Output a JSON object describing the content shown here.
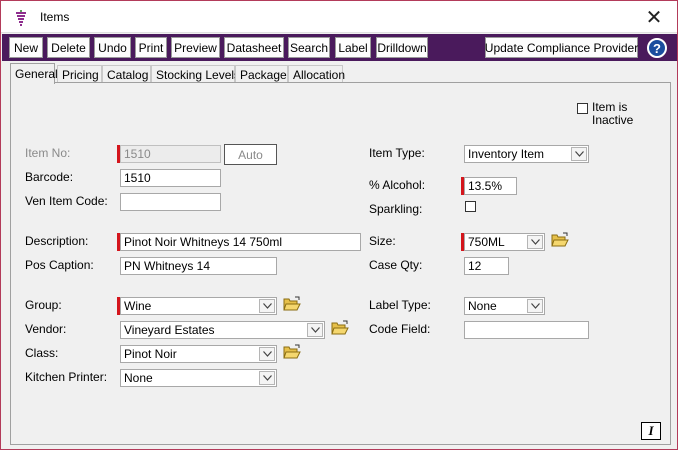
{
  "window": {
    "title": "Items",
    "close_glyph": "✕"
  },
  "toolbar": {
    "buttons": [
      "New",
      "Delete",
      "Undo",
      "Print",
      "Preview",
      "Datasheet",
      "Search",
      "Label",
      "Drilldown"
    ],
    "compliance_label": "Update Compliance Provider",
    "help_glyph": "?"
  },
  "tabs": [
    "General",
    "Pricing",
    "Catalog",
    "Stocking Levels",
    "Package",
    "Allocation"
  ],
  "form": {
    "inactive_label": "Item is Inactive",
    "item_no": {
      "label": "Item No:",
      "value": "1510"
    },
    "auto_label": "Auto",
    "barcode": {
      "label": "Barcode:",
      "value": "1510"
    },
    "ven_item_code": {
      "label": "Ven Item Code:",
      "value": ""
    },
    "description": {
      "label": "Description:",
      "value": "Pinot Noir Whitneys 14 750ml"
    },
    "pos_caption": {
      "label": "Pos Caption:",
      "value": "PN Whitneys 14"
    },
    "group": {
      "label": "Group:",
      "value": "Wine"
    },
    "vendor": {
      "label": "Vendor:",
      "value": "Vineyard Estates"
    },
    "class": {
      "label": "Class:",
      "value": "Pinot Noir"
    },
    "kitchen_printer": {
      "label": "Kitchen Printer:",
      "value": "None"
    },
    "item_type": {
      "label": "Item Type:",
      "value": "Inventory Item"
    },
    "alcohol": {
      "label": "% Alcohol:",
      "value": "13.5%"
    },
    "sparkling": {
      "label": "Sparkling:",
      "checked": false
    },
    "size": {
      "label": "Size:",
      "value": "750ML"
    },
    "case_qty": {
      "label": "Case Qty:",
      "value": "12"
    },
    "label_type": {
      "label": "Label Type:",
      "value": "None"
    },
    "code_field": {
      "label": "Code Field:",
      "value": ""
    },
    "italic_glyph": "I"
  },
  "colors": {
    "toolbar": "#4a1a5c",
    "required": "#d4151c",
    "help": "#1a4d9e"
  }
}
